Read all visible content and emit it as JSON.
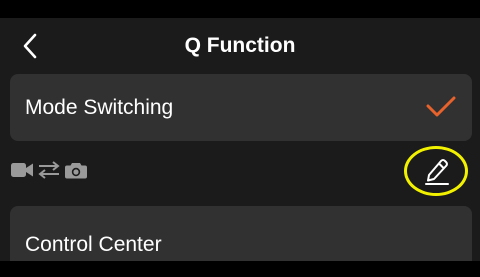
{
  "header": {
    "title": "Q Function",
    "back_icon": "chevron-left-icon"
  },
  "modes": {
    "selected_label": "Mode Switching",
    "selected_icon": "checkmark-icon",
    "switch_icons": [
      "video-camera-icon",
      "swap-arrows-icon",
      "photo-camera-icon"
    ],
    "edit_icon": "pencil-edit-icon"
  },
  "items": {
    "control_center_label": "Control Center"
  },
  "colors": {
    "background": "#1b1b1b",
    "card": "#313131",
    "accent_check": "#e8622c",
    "highlight_ring": "#f2f200",
    "icon_gray": "#9a9a9a"
  }
}
